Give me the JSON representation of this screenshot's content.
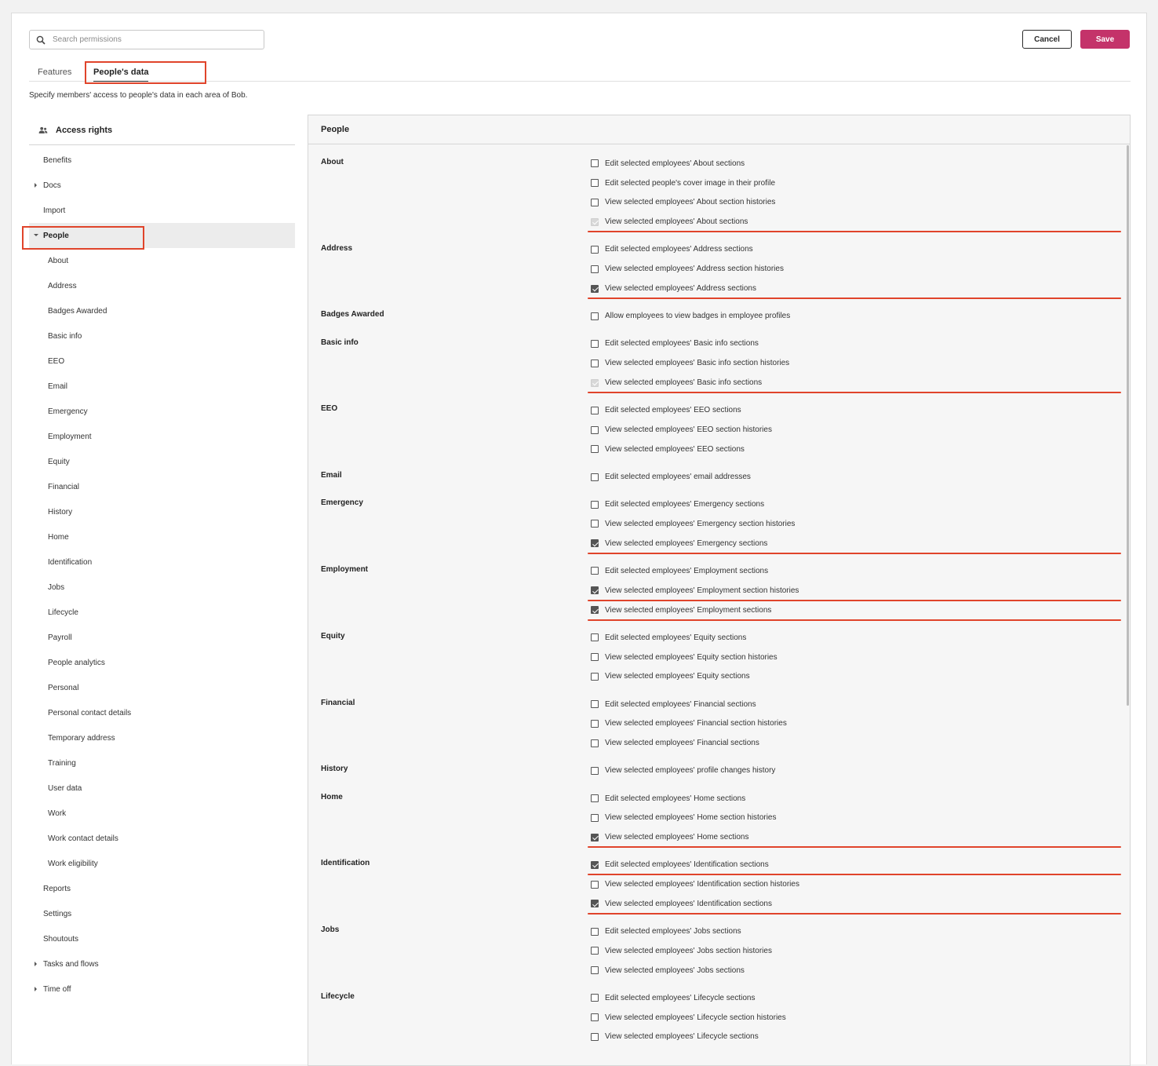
{
  "search": {
    "placeholder": "Search permissions"
  },
  "buttons": {
    "cancel": "Cancel",
    "save": "Save"
  },
  "tabs": {
    "features": "Features",
    "peoples_data": "People's data"
  },
  "description": "Specify members' access to people's data in each area of Bob.",
  "sidebar": {
    "heading": "Access rights",
    "items": [
      {
        "label": "Benefits",
        "level": 1,
        "caret": ""
      },
      {
        "label": "Docs",
        "level": 1,
        "caret": "right"
      },
      {
        "label": "Import",
        "level": 1,
        "caret": ""
      },
      {
        "label": "People",
        "level": 1,
        "caret": "down",
        "active": true
      },
      {
        "label": "About",
        "level": 2
      },
      {
        "label": "Address",
        "level": 2
      },
      {
        "label": "Badges Awarded",
        "level": 2
      },
      {
        "label": "Basic info",
        "level": 2
      },
      {
        "label": "EEO",
        "level": 2
      },
      {
        "label": "Email",
        "level": 2
      },
      {
        "label": "Emergency",
        "level": 2
      },
      {
        "label": "Employment",
        "level": 2
      },
      {
        "label": "Equity",
        "level": 2
      },
      {
        "label": "Financial",
        "level": 2
      },
      {
        "label": "History",
        "level": 2
      },
      {
        "label": "Home",
        "level": 2
      },
      {
        "label": "Identification",
        "level": 2
      },
      {
        "label": "Jobs",
        "level": 2
      },
      {
        "label": "Lifecycle",
        "level": 2
      },
      {
        "label": "Payroll",
        "level": 2
      },
      {
        "label": "People analytics",
        "level": 2
      },
      {
        "label": "Personal",
        "level": 2
      },
      {
        "label": "Personal contact details",
        "level": 2
      },
      {
        "label": "Temporary address",
        "level": 2
      },
      {
        "label": "Training",
        "level": 2
      },
      {
        "label": "User data",
        "level": 2
      },
      {
        "label": "Work",
        "level": 2
      },
      {
        "label": "Work contact details",
        "level": 2
      },
      {
        "label": "Work eligibility",
        "level": 2
      },
      {
        "label": "Reports",
        "level": 1,
        "caret": ""
      },
      {
        "label": "Settings",
        "level": 1,
        "caret": ""
      },
      {
        "label": "Shoutouts",
        "level": 1,
        "caret": ""
      },
      {
        "label": "Tasks and flows",
        "level": 1,
        "caret": "right"
      },
      {
        "label": "Time off",
        "level": 1,
        "caret": "right"
      }
    ]
  },
  "panel": {
    "title": "People",
    "sections": [
      {
        "name": "About",
        "options": [
          {
            "label": "Edit selected employees' About sections",
            "state": "unchecked"
          },
          {
            "label": "Edit selected people's cover image in their profile",
            "state": "unchecked"
          },
          {
            "label": "View selected employees' About section histories",
            "state": "unchecked"
          },
          {
            "label": "View selected employees' About sections",
            "state": "disabled",
            "marked": true
          }
        ]
      },
      {
        "name": "Address",
        "options": [
          {
            "label": "Edit selected employees' Address sections",
            "state": "unchecked"
          },
          {
            "label": "View selected employees' Address section histories",
            "state": "unchecked"
          },
          {
            "label": "View selected employees' Address sections",
            "state": "checked",
            "marked": true
          }
        ]
      },
      {
        "name": "Badges Awarded",
        "options": [
          {
            "label": "Allow employees to view badges in employee profiles",
            "state": "unchecked"
          }
        ]
      },
      {
        "name": "Basic info",
        "options": [
          {
            "label": "Edit selected employees' Basic info sections",
            "state": "unchecked"
          },
          {
            "label": "View selected employees' Basic info section histories",
            "state": "unchecked"
          },
          {
            "label": "View selected employees' Basic info sections",
            "state": "disabled",
            "marked": true
          }
        ]
      },
      {
        "name": "EEO",
        "options": [
          {
            "label": "Edit selected employees' EEO sections",
            "state": "unchecked"
          },
          {
            "label": "View selected employees' EEO section histories",
            "state": "unchecked"
          },
          {
            "label": "View selected employees' EEO sections",
            "state": "unchecked"
          }
        ]
      },
      {
        "name": "Email",
        "options": [
          {
            "label": "Edit selected employees' email addresses",
            "state": "unchecked"
          }
        ]
      },
      {
        "name": "Emergency",
        "options": [
          {
            "label": "Edit selected employees' Emergency sections",
            "state": "unchecked"
          },
          {
            "label": "View selected employees' Emergency section histories",
            "state": "unchecked"
          },
          {
            "label": "View selected employees' Emergency sections",
            "state": "checked",
            "marked": true
          }
        ]
      },
      {
        "name": "Employment",
        "options": [
          {
            "label": "Edit selected employees' Employment sections",
            "state": "unchecked"
          },
          {
            "label": "View selected employees' Employment section histories",
            "state": "checked",
            "marked": true
          },
          {
            "label": "View selected employees' Employment sections",
            "state": "checked",
            "marked": true
          }
        ]
      },
      {
        "name": "Equity",
        "options": [
          {
            "label": "Edit selected employees' Equity sections",
            "state": "unchecked"
          },
          {
            "label": "View selected employees' Equity section histories",
            "state": "unchecked"
          },
          {
            "label": "View selected employees' Equity sections",
            "state": "unchecked"
          }
        ]
      },
      {
        "name": "Financial",
        "options": [
          {
            "label": "Edit selected employees' Financial sections",
            "state": "unchecked"
          },
          {
            "label": "View selected employees' Financial section histories",
            "state": "unchecked"
          },
          {
            "label": "View selected employees' Financial sections",
            "state": "unchecked"
          }
        ]
      },
      {
        "name": "History",
        "options": [
          {
            "label": "View selected employees' profile changes history",
            "state": "unchecked"
          }
        ]
      },
      {
        "name": "Home",
        "options": [
          {
            "label": "Edit selected employees' Home sections",
            "state": "unchecked"
          },
          {
            "label": "View selected employees' Home section histories",
            "state": "unchecked"
          },
          {
            "label": "View selected employees' Home sections",
            "state": "checked",
            "marked": true
          }
        ]
      },
      {
        "name": "Identification",
        "options": [
          {
            "label": "Edit selected employees' Identification sections",
            "state": "checked",
            "marked": true
          },
          {
            "label": "View selected employees' Identification section histories",
            "state": "unchecked"
          },
          {
            "label": "View selected employees' Identification sections",
            "state": "checked",
            "marked": true
          }
        ]
      },
      {
        "name": "Jobs",
        "options": [
          {
            "label": "Edit selected employees' Jobs sections",
            "state": "unchecked"
          },
          {
            "label": "View selected employees' Jobs section histories",
            "state": "unchecked"
          },
          {
            "label": "View selected employees' Jobs sections",
            "state": "unchecked"
          }
        ]
      },
      {
        "name": "Lifecycle",
        "options": [
          {
            "label": "Edit selected employees' Lifecycle sections",
            "state": "unchecked"
          },
          {
            "label": "View selected employees' Lifecycle section histories",
            "state": "unchecked"
          },
          {
            "label": "View selected employees' Lifecycle sections",
            "state": "unchecked"
          }
        ]
      }
    ]
  },
  "colors": {
    "accent": "#c4336a",
    "annotation": "#e0442b",
    "checkbox": "#555555"
  },
  "icons": {
    "search": "search-icon",
    "access_rights": "people-icon"
  }
}
